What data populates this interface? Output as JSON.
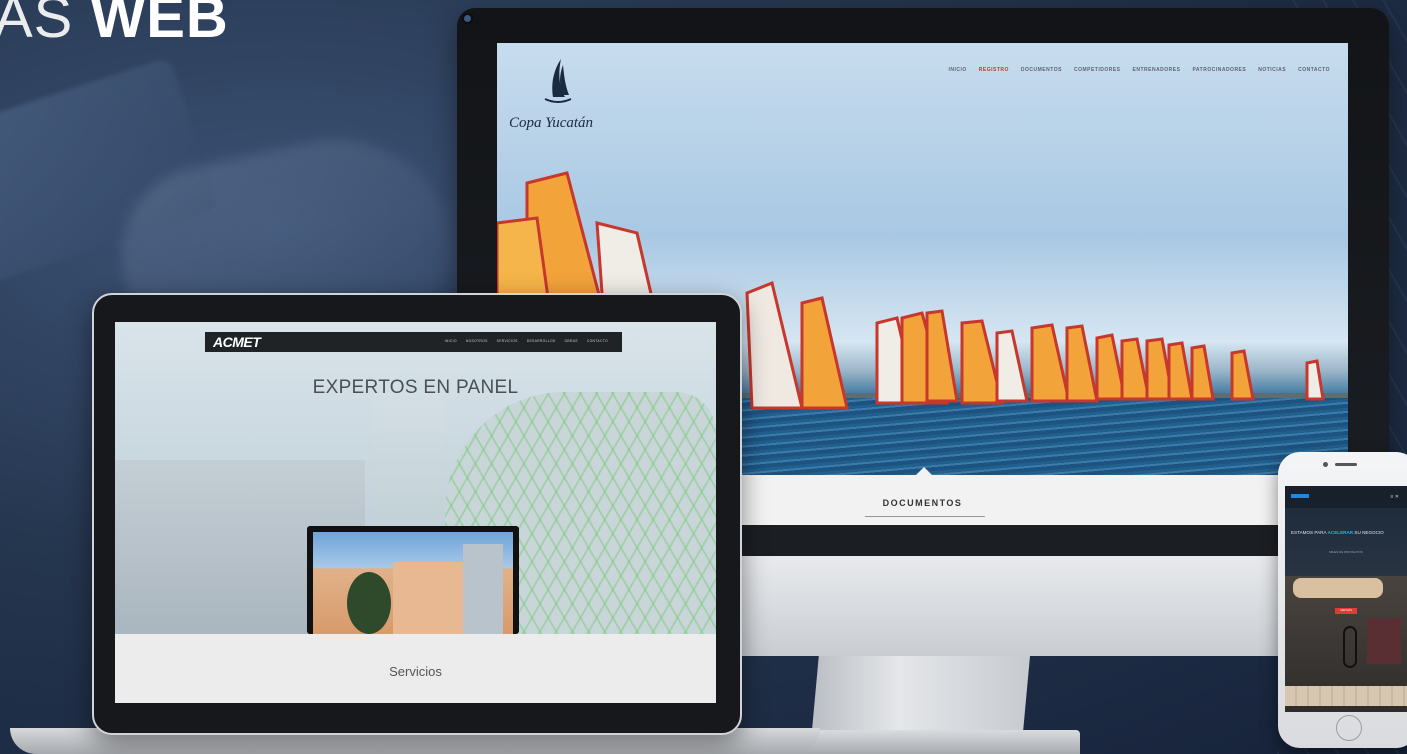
{
  "headline": {
    "light": "AS",
    "bold": "WEB"
  },
  "imac_site": {
    "brand": "Copa Yucatán",
    "nav": [
      {
        "label": "INICIO",
        "active": false
      },
      {
        "label": "REGISTRO",
        "active": true
      },
      {
        "label": "DOCUMENTOS",
        "active": false
      },
      {
        "label": "COMPETIDORES",
        "active": false
      },
      {
        "label": "ENTRENADORES",
        "active": false
      },
      {
        "label": "PATROCINADORES",
        "active": false
      },
      {
        "label": "NOTICIAS",
        "active": false
      },
      {
        "label": "CONTACTO",
        "active": false
      }
    ],
    "section_title": "DOCUMENTOS"
  },
  "laptop_site": {
    "logo": "ACMET",
    "nav": [
      "INICIO",
      "NOSOTROS",
      "SERVICIOS",
      "DESARROLLOS",
      "OBRAS",
      "CONTACTO"
    ],
    "hero": "EXPERTOS EN PANEL",
    "section_title": "Servicios"
  },
  "phone_site": {
    "menu": "≡ ✕",
    "headline_before": "ESTAMOS PARA",
    "headline_accent": "ACELERAR",
    "headline_after": "SU NEGOCIO",
    "sub": "MILES DE PROYECTOS",
    "button": "VER MÁS"
  },
  "colors": {
    "accent_red": "#c0392b",
    "accent_cyan": "#1fb6e8",
    "bg_navy": "#25364f"
  }
}
